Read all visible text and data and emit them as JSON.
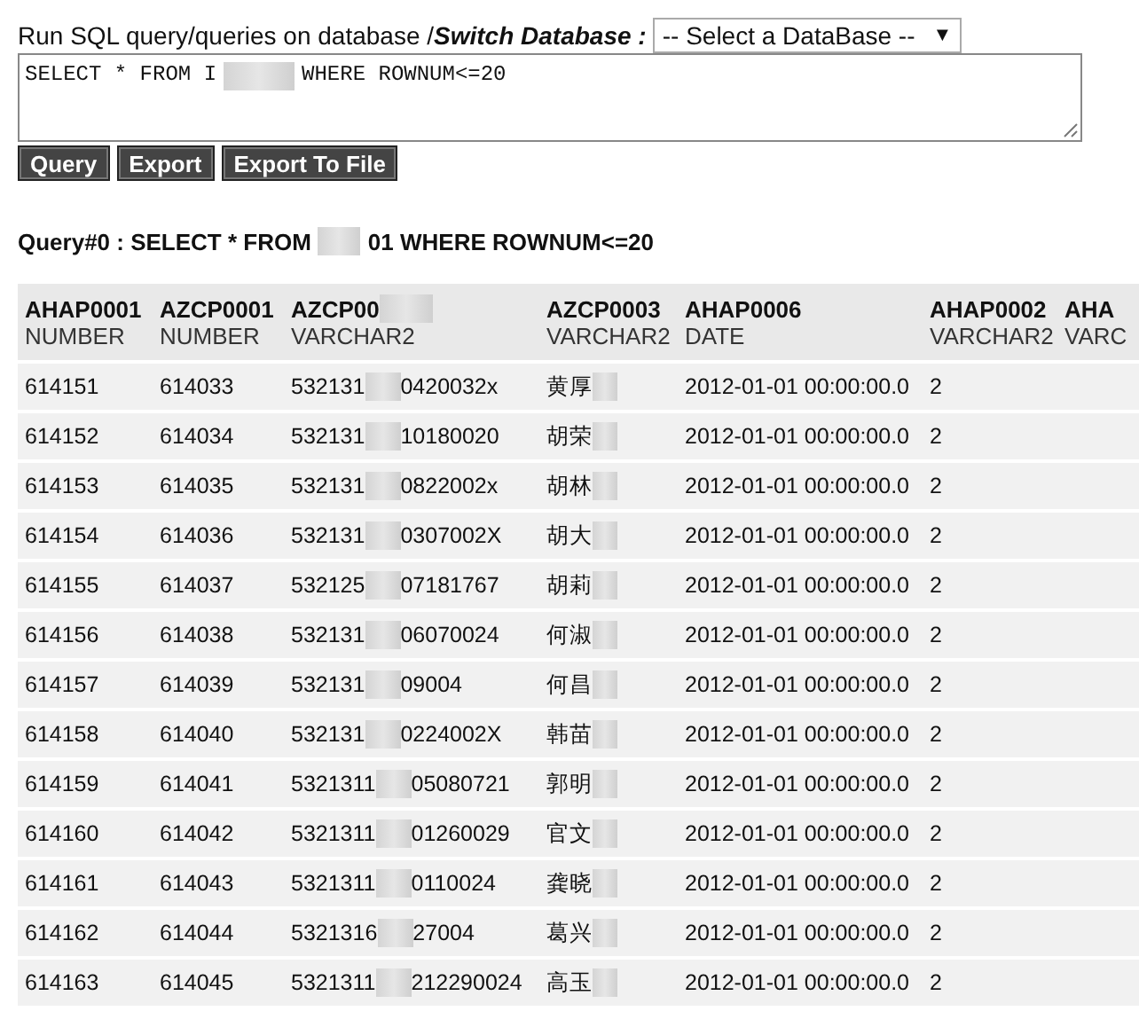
{
  "prompt": {
    "label": "Run SQL query/queries on database / ",
    "switch_label": "Switch Database :",
    "database_select": "-- Select a DataBase --",
    "select_arrow": "▼"
  },
  "query_field": {
    "before": "SELECT * FROM I",
    "after": "WHERE ROWNUM<=20"
  },
  "buttons": [
    "Query",
    "Export",
    "Export To File"
  ],
  "query_title": {
    "before": "Query#0 : SELECT * FROM",
    "after": "01 WHERE ROWNUM<=20"
  },
  "table": {
    "columns": [
      {
        "name": "AHAP0001",
        "type": "NUMBER"
      },
      {
        "name": "AZCP0001",
        "type": "NUMBER"
      },
      {
        "name": "AZCP00",
        "type": "VARCHAR2",
        "redacted": true
      },
      {
        "name": "AZCP0003",
        "type": "VARCHAR2"
      },
      {
        "name": "AHAP0006",
        "type": "DATE"
      },
      {
        "name": "AHAP0002",
        "type": "VARCHAR2"
      },
      {
        "name": "AHA",
        "type": "VARC"
      }
    ],
    "rows": [
      {
        "c1": "614151",
        "c2": "614033",
        "c3": [
          "532131",
          "0420032x"
        ],
        "c4": "黄厚",
        "c5": "2012-01-01 00:00:00.0",
        "c6": "2"
      },
      {
        "c1": "614152",
        "c2": "614034",
        "c3": [
          "532131",
          "10180020"
        ],
        "c4": "胡荣",
        "c5": "2012-01-01 00:00:00.0",
        "c6": "2"
      },
      {
        "c1": "614153",
        "c2": "614035",
        "c3": [
          "532131",
          "0822002x"
        ],
        "c4": "胡林",
        "c5": "2012-01-01 00:00:00.0",
        "c6": "2"
      },
      {
        "c1": "614154",
        "c2": "614036",
        "c3": [
          "532131",
          "0307002X"
        ],
        "c4": "胡大",
        "c5": "2012-01-01 00:00:00.0",
        "c6": "2"
      },
      {
        "c1": "614155",
        "c2": "614037",
        "c3": [
          "532125",
          "07181767"
        ],
        "c4": "胡莉",
        "c5": "2012-01-01 00:00:00.0",
        "c6": "2"
      },
      {
        "c1": "614156",
        "c2": "614038",
        "c3": [
          "532131",
          "06070024"
        ],
        "c4": "何淑",
        "c5": "2012-01-01 00:00:00.0",
        "c6": "2"
      },
      {
        "c1": "614157",
        "c2": "614039",
        "c3": [
          "532131",
          "09004"
        ],
        "c4": "何昌",
        "c5": "2012-01-01 00:00:00.0",
        "c6": "2"
      },
      {
        "c1": "614158",
        "c2": "614040",
        "c3": [
          "532131",
          "0224002X"
        ],
        "c4": "韩苗",
        "c5": "2012-01-01 00:00:00.0",
        "c6": "2"
      },
      {
        "c1": "614159",
        "c2": "614041",
        "c3": [
          "5321311",
          "05080721"
        ],
        "c4": "郭明",
        "c5": "2012-01-01 00:00:00.0",
        "c6": "2"
      },
      {
        "c1": "614160",
        "c2": "614042",
        "c3": [
          "5321311",
          "01260029"
        ],
        "c4": "官文",
        "c5": "2012-01-01 00:00:00.0",
        "c6": "2"
      },
      {
        "c1": "614161",
        "c2": "614043",
        "c3": [
          "5321311",
          "0110024"
        ],
        "c4": "龚晓",
        "c5": "2012-01-01 00:00:00.0",
        "c6": "2"
      },
      {
        "c1": "614162",
        "c2": "614044",
        "c3": [
          "5321316",
          "27004"
        ],
        "c4": "葛兴",
        "c5": "2012-01-01 00:00:00.0",
        "c6": "2"
      },
      {
        "c1": "614163",
        "c2": "614045",
        "c3": [
          "5321311",
          "212290024"
        ],
        "c4": "高玉",
        "c5": "2012-01-01 00:00:00.0",
        "c6": "2"
      }
    ]
  }
}
